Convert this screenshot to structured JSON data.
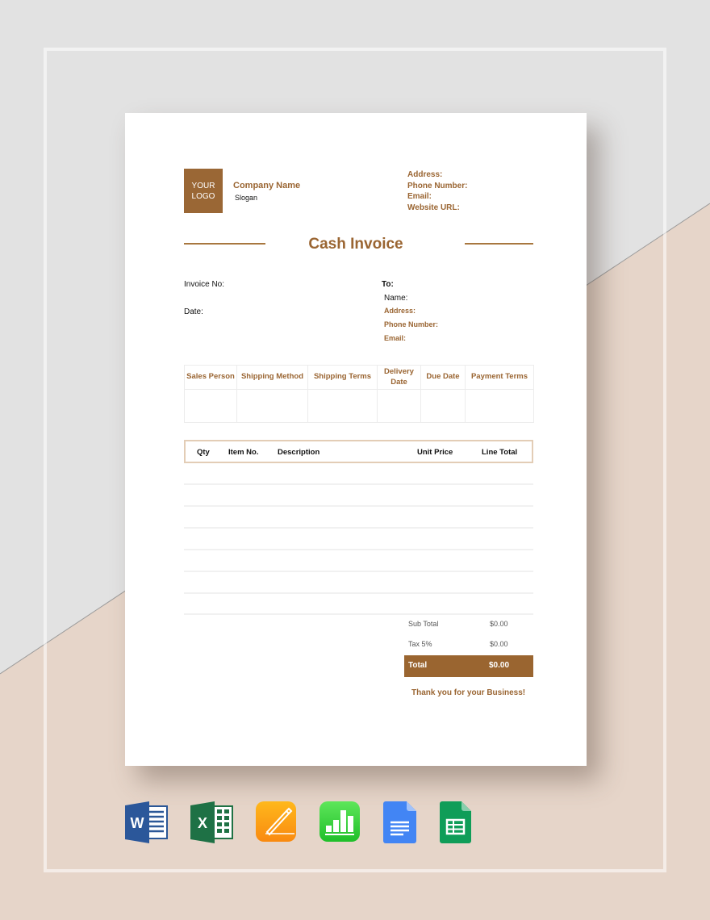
{
  "colors": {
    "accent": "#9a6532",
    "bg_top": "#e2e2e2",
    "bg_bottom": "#e6d5c9"
  },
  "header": {
    "logo_line1": "YOUR",
    "logo_line2": "LOGO",
    "company_name": "Company Name",
    "slogan": "Slogan",
    "contact": [
      "Address:",
      "Phone Number:",
      "Email:",
      "Website URL:"
    ]
  },
  "title": "Cash Invoice",
  "meta": {
    "invoice_no_label": "Invoice No:",
    "date_label": "Date:"
  },
  "recipient": {
    "to_label": "To:",
    "name_label": "Name:",
    "address_label": "Address:",
    "phone_label": "Phone Number:",
    "email_label": "Email:"
  },
  "shipping_table": {
    "headers": [
      "Sales Person",
      "Shipping Method",
      "Shipping Terms",
      "Delivery Date",
      "Due Date",
      "Payment Terms"
    ],
    "rows": [
      [
        "",
        "",
        "",
        "",
        "",
        ""
      ]
    ]
  },
  "items_table": {
    "headers": [
      "Qty",
      "Item No.",
      "Description",
      "Unit Price",
      "Line Total"
    ],
    "rows": [
      [],
      [],
      [],
      [],
      [],
      [],
      []
    ]
  },
  "summary": {
    "subtotal_label": "Sub Total",
    "subtotal_value": "$0.00",
    "tax_label": "Tax 5%",
    "tax_value": "$0.00",
    "total_label": "Total",
    "total_value": "$0.00"
  },
  "thanks": "Thank you for your Business!",
  "formats": [
    {
      "name": "Microsoft Word",
      "icon": "word-icon"
    },
    {
      "name": "Microsoft Excel",
      "icon": "excel-icon"
    },
    {
      "name": "Apple Pages",
      "icon": "pages-icon"
    },
    {
      "name": "Apple Numbers",
      "icon": "numbers-icon"
    },
    {
      "name": "Google Docs",
      "icon": "google-docs-icon"
    },
    {
      "name": "Google Sheets",
      "icon": "google-sheets-icon"
    }
  ]
}
